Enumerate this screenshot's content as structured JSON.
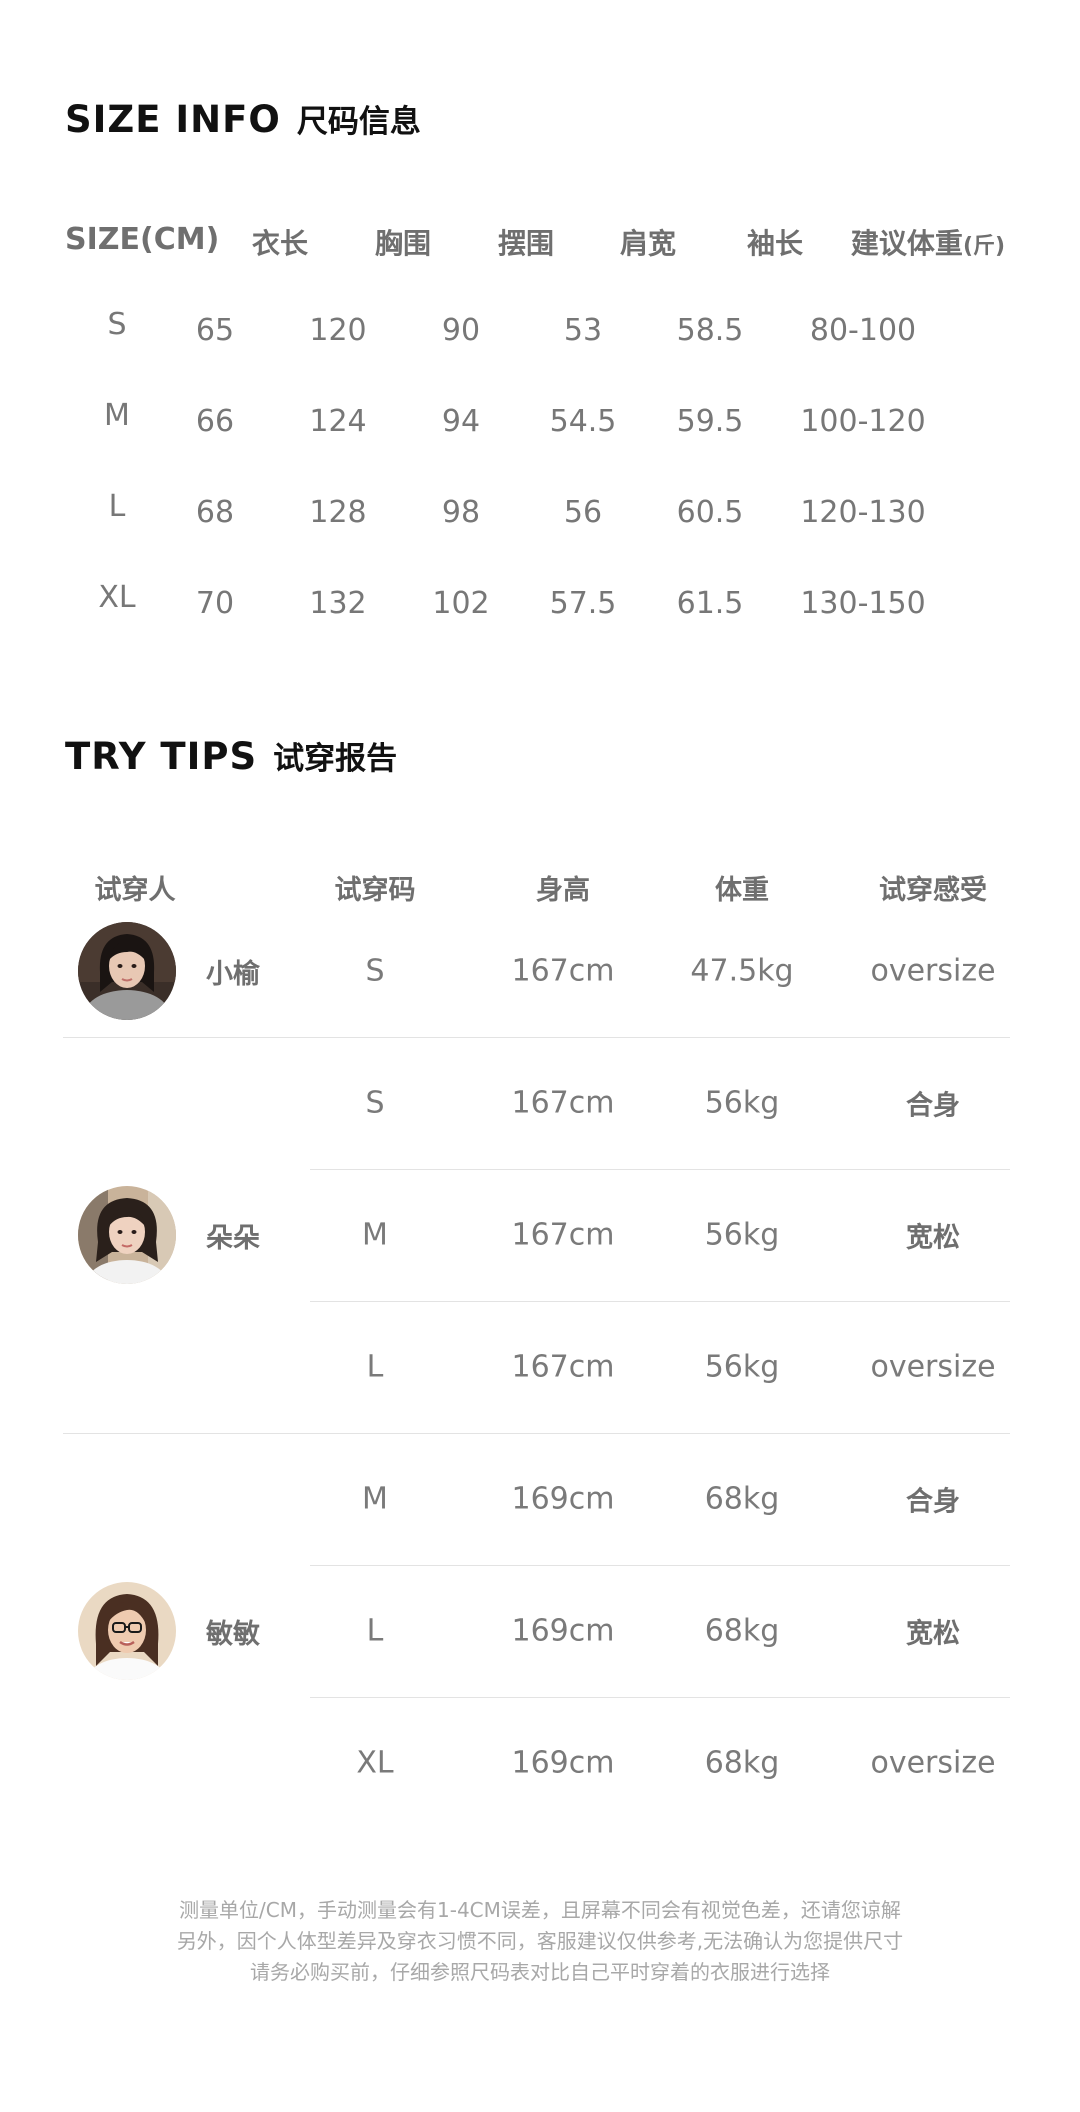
{
  "size_info": {
    "title_en": "SIZE INFO",
    "title_cn": "尺码信息",
    "headers": [
      "SIZE(CM)",
      "衣长",
      "胸围",
      "摆围",
      "肩宽",
      "袖长",
      "建议体重"
    ],
    "weight_unit": "(斤)",
    "rows": [
      [
        "S",
        "65",
        "120",
        "90",
        "53",
        "58.5",
        "80-100"
      ],
      [
        "M",
        "66",
        "124",
        "94",
        "54.5",
        "59.5",
        "100-120"
      ],
      [
        "L",
        "68",
        "128",
        "98",
        "56",
        "60.5",
        "120-130"
      ],
      [
        "XL",
        "70",
        "132",
        "102",
        "57.5",
        "61.5",
        "130-150"
      ]
    ]
  },
  "try_tips": {
    "title_en": "TRY TIPS",
    "title_cn": "试穿报告",
    "headers": [
      "试穿人",
      "试穿码",
      "身高",
      "体重",
      "试穿感受"
    ],
    "testers": [
      {
        "name": "小榆",
        "rows": [
          [
            "S",
            "167cm",
            "47.5kg",
            "oversize"
          ]
        ]
      },
      {
        "name": "朵朵",
        "rows": [
          [
            "S",
            "167cm",
            "56kg",
            "合身"
          ],
          [
            "M",
            "167cm",
            "56kg",
            "宽松"
          ],
          [
            "L",
            "167cm",
            "56kg",
            "oversize"
          ]
        ]
      },
      {
        "name": "敏敏",
        "rows": [
          [
            "M",
            "169cm",
            "68kg",
            "合身"
          ],
          [
            "L",
            "169cm",
            "68kg",
            "宽松"
          ],
          [
            "XL",
            "169cm",
            "68kg",
            "oversize"
          ]
        ]
      }
    ]
  },
  "footnote": [
    "测量单位/CM，手动测量会有1-4CM误差，且屏幕不同会有视觉色差，还请您谅解",
    "另外，因个人体型差异及穿衣习惯不同，客服建议仅供参考,无法确认为您提供尺寸",
    "请务必购买前，仔细参照尺码表对比自己平时穿着的衣服进行选择"
  ]
}
